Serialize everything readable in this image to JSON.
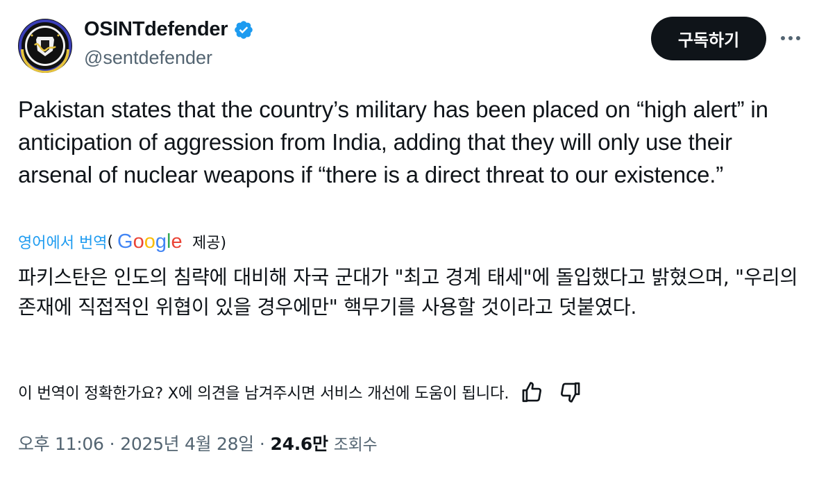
{
  "author": {
    "display_name": "OSINTdefender",
    "handle": "@sentdefender",
    "avatar_icon": "shield-emblem-logo",
    "verified": true,
    "verified_color": "#1d9bf0"
  },
  "actions": {
    "subscribe_label": "구독하기",
    "more_icon": "more-horizontal-icon"
  },
  "tweet": {
    "text": "Pakistan states that the country’s military has been placed on “high alert” in anticipation of aggression from India, adding that they will only use their arsenal of nuclear weapons if “there is a direct threat to our existence.”"
  },
  "translation": {
    "link_label": "영어에서 번역",
    "open_paren": "(",
    "provider_logo": "Google",
    "provided_label": "제공)",
    "text": "파키스탄은 인도의 침략에 대비해 자국 군대가 \"최고 경계 태세\"에 돌입했다고 밝혔으며, \"우리의 존재에 직접적인 위협이 있을 경우에만\" 핵무기를 사용할 것이라고 덧붙였다.",
    "feedback_prompt": "이 번역이 정확한가요? X에 의견을 남겨주시면 서비스 개선에 도움이 됩니다.",
    "feedback_icons": [
      "thumbs-up-icon",
      "thumbs-down-icon"
    ]
  },
  "meta": {
    "time": "오후 11:06",
    "separator": "·",
    "date": "2025년 4월 28일",
    "views_count": "24.6만",
    "views_label": "조회수"
  },
  "colors": {
    "text_primary": "#0f1419",
    "text_secondary": "#536471",
    "link": "#1d9bf0",
    "button_bg": "#0f1419"
  }
}
